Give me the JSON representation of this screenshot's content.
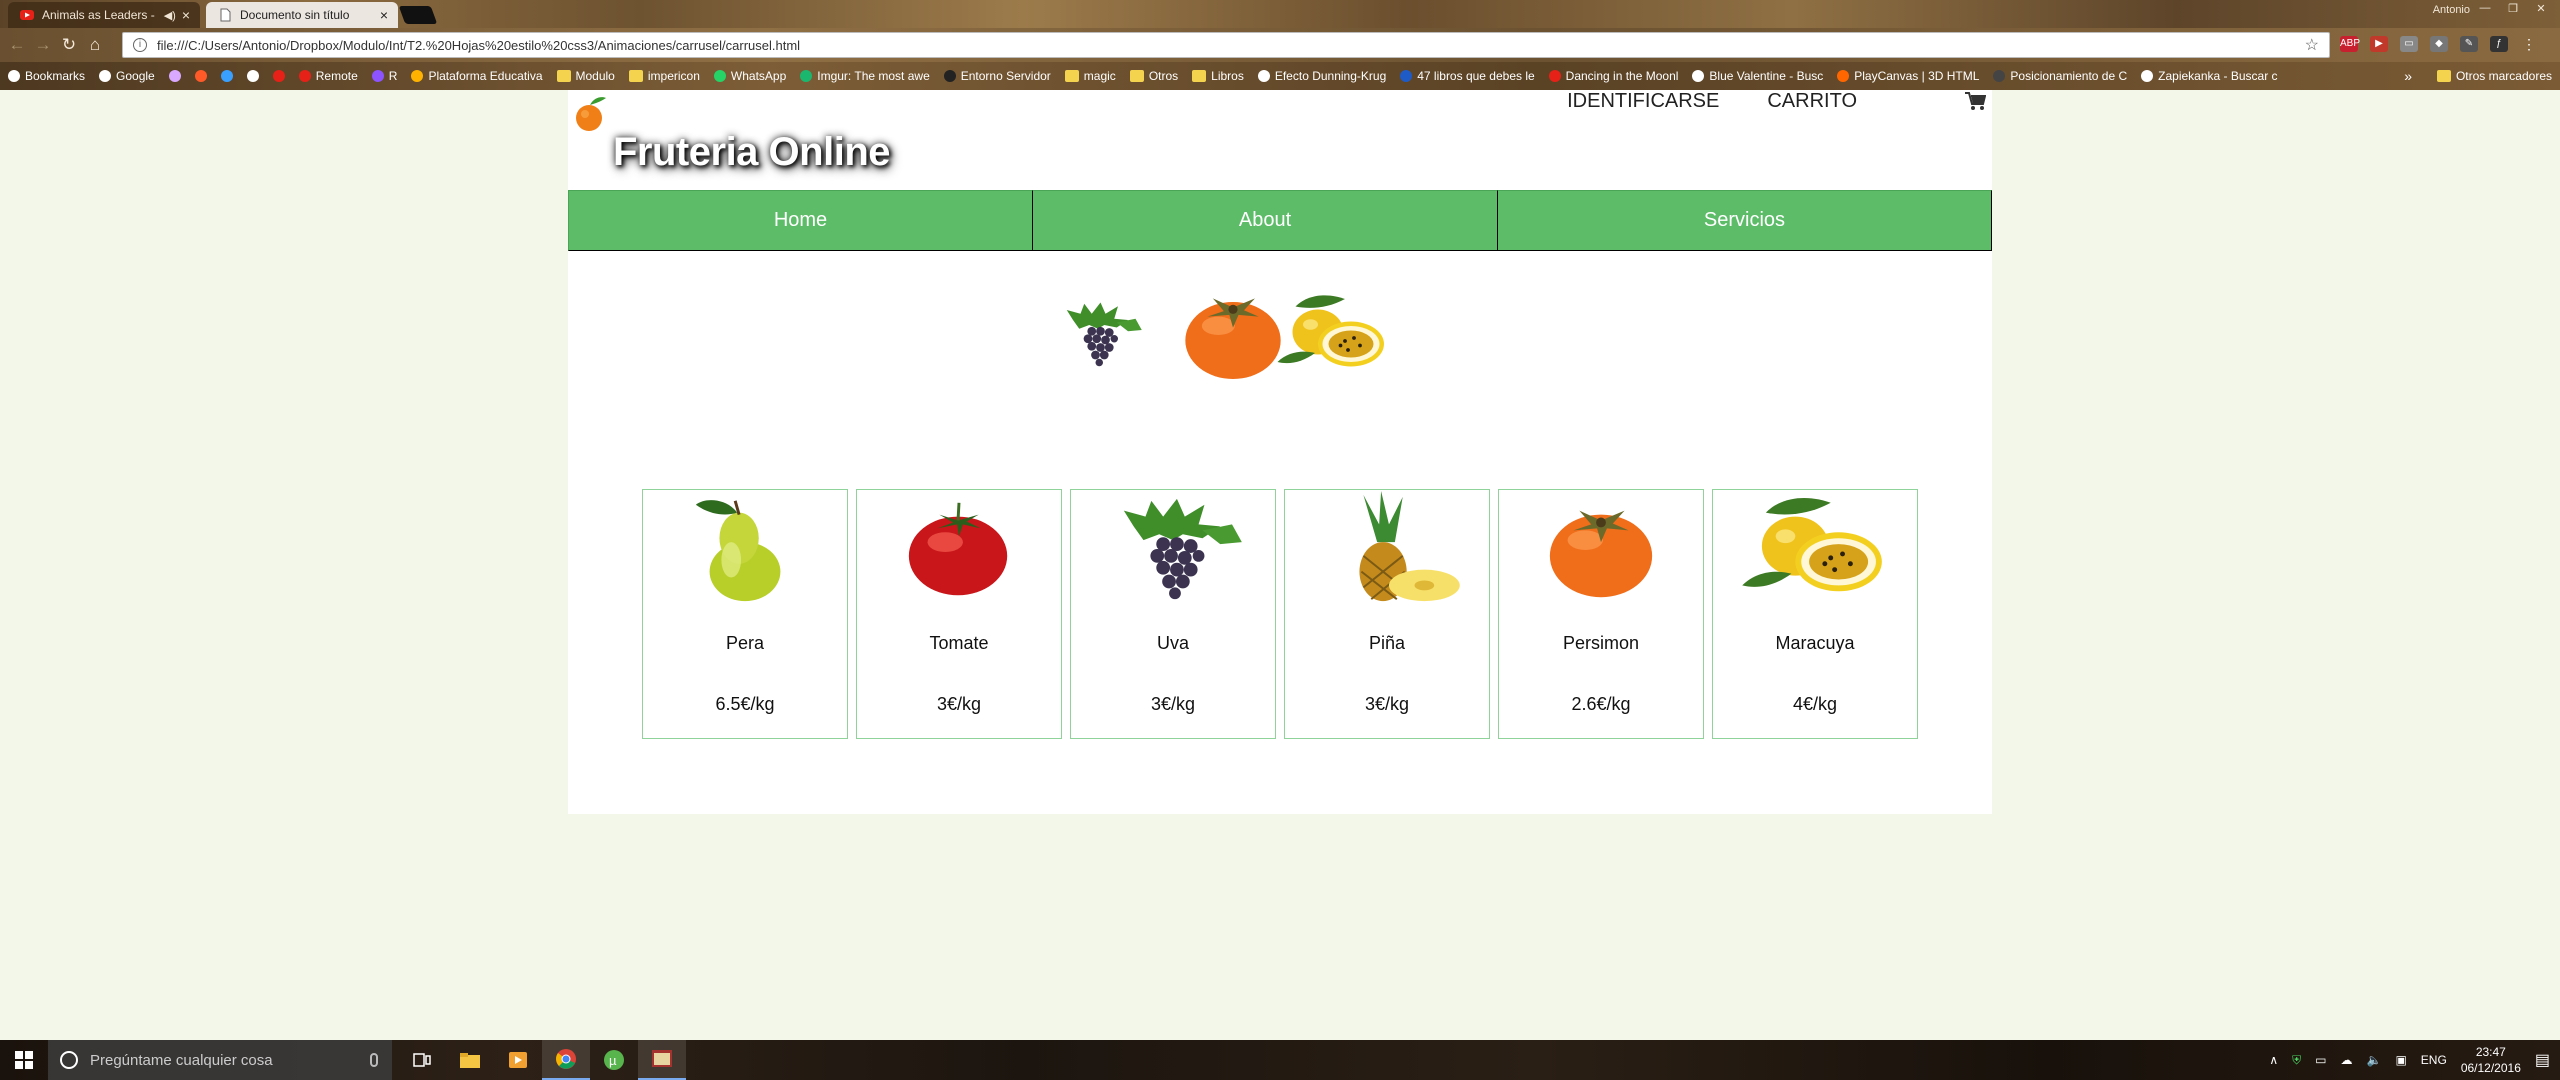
{
  "browser": {
    "tabs": [
      {
        "title": "Animals as Leaders -",
        "active": false,
        "audio": true
      },
      {
        "title": "Documento sin título",
        "active": true
      }
    ],
    "profile": "Antonio",
    "url": "file:///C:/Users/Antonio/Dropbox/Modulo/Int/T2.%20Hojas%20estilo%20css3/Animaciones/carrusel/carrusel.html",
    "bookmarks": [
      {
        "label": "Bookmarks",
        "icon": "star-icon",
        "color": "#ffffff"
      },
      {
        "label": "Google",
        "icon": "google-icon",
        "color": "#ffffff"
      },
      {
        "label": "",
        "icon": "wave-icon",
        "color": "#d9a8ff"
      },
      {
        "label": "",
        "icon": "fire-icon",
        "color": "#ff5a28"
      },
      {
        "label": "",
        "icon": "windows-icon",
        "color": "#3aa0ff"
      },
      {
        "label": "",
        "icon": "steam-icon",
        "color": "#ffffff"
      },
      {
        "label": "",
        "icon": "youtube-icon",
        "color": "#e62117"
      },
      {
        "label": "Remote",
        "icon": "youtube-icon",
        "color": "#e62117"
      },
      {
        "label": "R",
        "icon": "r-icon",
        "color": "#8c53ff"
      },
      {
        "label": "Plataforma Educativa",
        "icon": "m-icon",
        "color": "#ffb300"
      },
      {
        "label": "Modulo",
        "icon": "folder-icon",
        "color": "#f4d34e"
      },
      {
        "label": "impericon",
        "icon": "folder-icon",
        "color": "#f4d34e"
      },
      {
        "label": "WhatsApp",
        "icon": "whatsapp-icon",
        "color": "#25d366"
      },
      {
        "label": "Imgur: The most awe",
        "icon": "imgur-icon",
        "color": "#1bb76e"
      },
      {
        "label": "Entorno Servidor",
        "icon": "github-icon",
        "color": "#222222"
      },
      {
        "label": "magic",
        "icon": "folder-icon",
        "color": "#f4d34e"
      },
      {
        "label": "Otros",
        "icon": "folder-icon",
        "color": "#f4d34e"
      },
      {
        "label": "Libros",
        "icon": "folder-icon",
        "color": "#f4d34e"
      },
      {
        "label": "Efecto Dunning-Krug",
        "icon": "wikipedia-icon",
        "color": "#ffffff"
      },
      {
        "label": "47 libros que debes le",
        "icon": "ti-icon",
        "color": "#1e5bc6"
      },
      {
        "label": "Dancing in the Moonl",
        "icon": "youtube-icon",
        "color": "#e62117"
      },
      {
        "label": "Blue Valentine - Busc",
        "icon": "google-icon",
        "color": "#ffffff"
      },
      {
        "label": "PlayCanvas | 3D HTML",
        "icon": "playcanvas-icon",
        "color": "#ff6600"
      },
      {
        "label": "Posicionamiento de C",
        "icon": "page-icon",
        "color": "#444444"
      },
      {
        "label": "Zapiekanka - Buscar c",
        "icon": "google-icon",
        "color": "#ffffff"
      }
    ],
    "bookmarks_more": "»",
    "other_bookmarks": "Otros marcadores"
  },
  "site": {
    "title": "Fruteria Online",
    "top_links": [
      "IDENTIFICARSE",
      "CARRITO"
    ],
    "nav": [
      "Home",
      "About",
      "Servicios"
    ],
    "accent": "#5cbc68",
    "carousel": [
      "grapes",
      "persimmon",
      "passion-fruit"
    ],
    "products": [
      {
        "name": "Pera",
        "price": "6.5€/kg",
        "fruit": "pear"
      },
      {
        "name": "Tomate",
        "price": "3€/kg",
        "fruit": "tomato"
      },
      {
        "name": "Uva",
        "price": "3€/kg",
        "fruit": "grapes"
      },
      {
        "name": "Piña",
        "price": "3€/kg",
        "fruit": "pineapple"
      },
      {
        "name": "Persimon",
        "price": "2.6€/kg",
        "fruit": "persimmon"
      },
      {
        "name": "Maracuya",
        "price": "4€/kg",
        "fruit": "passion-fruit"
      }
    ]
  },
  "taskbar": {
    "search_placeholder": "Pregúntame cualquier cosa",
    "language": "ENG",
    "time": "23:47",
    "date": "06/12/2016"
  }
}
